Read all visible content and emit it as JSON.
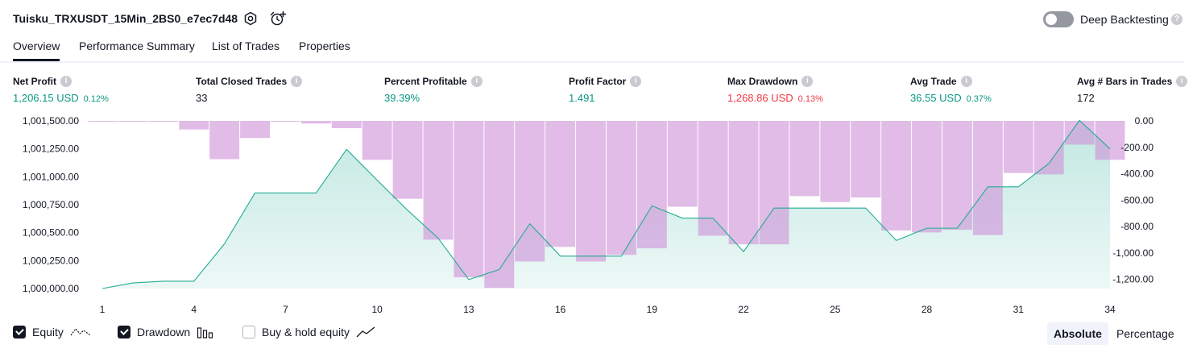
{
  "header": {
    "title": "Tuisku_TRXUSDT_15Min_2BS0_e7ec7d48",
    "deep_backtesting_label": "Deep Backtesting",
    "deep_backtesting_enabled": false
  },
  "tabs": [
    {
      "label": "Overview",
      "active": true
    },
    {
      "label": "Performance Summary",
      "active": false
    },
    {
      "label": "List of Trades",
      "active": false
    },
    {
      "label": "Properties",
      "active": false
    }
  ],
  "metrics": [
    {
      "label": "Net Profit",
      "value": "1,206.15 USD",
      "pct": "0.12%",
      "color": "#089981"
    },
    {
      "label": "Total Closed Trades",
      "value": "33",
      "pct": "",
      "color": "#131722"
    },
    {
      "label": "Percent Profitable",
      "value": "39.39%",
      "pct": "",
      "color": "#089981"
    },
    {
      "label": "Profit Factor",
      "value": "1.491",
      "pct": "",
      "color": "#089981"
    },
    {
      "label": "Max Drawdown",
      "value": "1,268.86 USD",
      "pct": "0.13%",
      "color": "#f23645"
    },
    {
      "label": "Avg Trade",
      "value": "36.55 USD",
      "pct": "0.37%",
      "color": "#089981"
    },
    {
      "label": "Avg # Bars in Trades",
      "value": "172",
      "pct": "",
      "color": "#131722"
    }
  ],
  "chart_data": {
    "type": "line",
    "x_tick_labels": [
      "1",
      "4",
      "7",
      "10",
      "13",
      "16",
      "19",
      "22",
      "25",
      "28",
      "31",
      "34"
    ],
    "left_axis": {
      "tick_labels": [
        "1,001,500.00",
        "1,001,250.00",
        "1,001,000.00",
        "1,000,750.00",
        "1,000,500.00",
        "1,000,250.00",
        "1,000,000.00"
      ],
      "ylim": [
        1000000,
        1001500
      ]
    },
    "right_axis": {
      "tick_labels": [
        "0.00",
        "-200.00",
        "-400.00",
        "-600.00",
        "-800.00",
        "-1,000.00",
        "-1,200.00"
      ],
      "ylim": [
        -1270,
        0
      ]
    },
    "series": [
      {
        "name": "Equity",
        "type": "area",
        "color": "#22ab94",
        "x": [
          1,
          2,
          3,
          4,
          5,
          6,
          7,
          8,
          9,
          10,
          11,
          12,
          13,
          14,
          15,
          16,
          17,
          18,
          19,
          20,
          21,
          22,
          23,
          24,
          25,
          26,
          27,
          28,
          29,
          30,
          31,
          32,
          33,
          34
        ],
        "values": [
          1000000,
          1000050,
          1000065,
          1000065,
          1000400,
          1000855,
          1000855,
          1000855,
          1001245,
          1000970,
          1000700,
          1000450,
          1000080,
          1000170,
          1000580,
          1000290,
          1000290,
          1000290,
          1000740,
          1000630,
          1000630,
          1000330,
          1000720,
          1000720,
          1000720,
          1000720,
          1000430,
          1000540,
          1000540,
          1000910,
          1000910,
          1001120,
          1001505,
          1001250
        ]
      },
      {
        "name": "Drawdown",
        "type": "bar",
        "color": "#ce93d8",
        "x": [
          1,
          2,
          3,
          4,
          5,
          6,
          7,
          8,
          9,
          10,
          11,
          12,
          13,
          14,
          15,
          16,
          17,
          18,
          19,
          20,
          21,
          22,
          23,
          24,
          25,
          26,
          27,
          28,
          29,
          30,
          31,
          32,
          33,
          34
        ],
        "values": [
          -5,
          -5,
          -5,
          -65,
          -290,
          -130,
          -5,
          -20,
          -55,
          -295,
          -590,
          -900,
          -1185,
          -1265,
          -1065,
          -955,
          -1065,
          -1015,
          -965,
          -650,
          -870,
          -935,
          -935,
          -570,
          -615,
          -580,
          -830,
          -845,
          -825,
          -865,
          -395,
          -405,
          -180,
          -295
        ]
      }
    ]
  },
  "legend": [
    {
      "label": "Equity",
      "checked": true,
      "icon": "equity-line-icon"
    },
    {
      "label": "Drawdown",
      "checked": true,
      "icon": "drawdown-bars-icon"
    },
    {
      "label": "Buy & hold equity",
      "checked": false,
      "icon": "buy-hold-line-icon"
    }
  ],
  "display_mode": {
    "options": [
      "Absolute",
      "Percentage"
    ],
    "selected": "Absolute"
  }
}
